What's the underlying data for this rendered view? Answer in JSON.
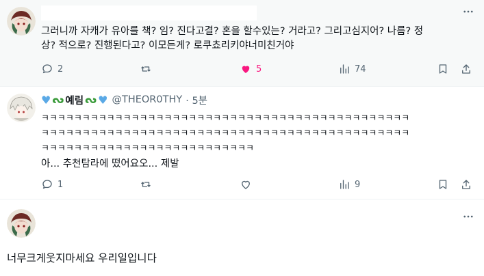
{
  "post1": {
    "text_line1": "그러니까 자캐가 유아를 책? 임? 진다고결? 혼을 할수있는? 거라고? 그리고심지어? 나름? 정",
    "text_line2": "상? 적으로? 진행된다고? 이모든게? 로쿠쵸리키야너미친거야",
    "replies": "2",
    "likes": "5",
    "views": "74"
  },
  "post2": {
    "display_name": "예림",
    "handle": "@THEOR0THY",
    "time": "· 5분",
    "laugh_line1": "ㅋㅋㅋㅋㅋㅋㅋㅋㅋㅋㅋㅋㅋㅋㅋㅋㅋㅋㅋㅋㅋㅋㅋㅋㅋㅋㅋㅋㅋㅋㅋㅋㅋㅋㅋㅋㅋㅋㅋㅋㅋㅋㅋㅋㅋ",
    "laugh_line2": "ㅋㅋㅋㅋㅋㅋㅋㅋㅋㅋㅋㅋㅋㅋㅋㅋㅋㅋㅋㅋㅋㅋㅋㅋㅋㅋㅋㅋㅋㅋㅋㅋㅋㅋㅋㅋㅋㅋㅋㅋㅋㅋㅋㅋㅋ",
    "laugh_line3": "ㅋㅋㅋㅋㅋㅋㅋㅋㅋㅋㅋㅋㅋㅋㅋㅋㅋㅋㅋㅋㅋㅋㅋㅋㅋㅋ",
    "text_line4": "아... 추천탐라에 떴어요오... 제발",
    "replies": "1",
    "views": "9"
  },
  "post3": {
    "text": "너무크게웃지마세요 우리일입니다"
  },
  "icons": {
    "more": "more-horizontal-icon",
    "reply": "reply-bubble-icon",
    "retweet": "retweet-icon",
    "like": "heart-icon",
    "views": "views-bar-chart-icon",
    "bookmark": "bookmark-icon",
    "share": "share-upload-icon"
  },
  "colors": {
    "like_active": "#f91880",
    "muted": "#536471",
    "heart_emoji": "#5aa9e6",
    "leaf_emoji": "#3a9b3a"
  }
}
